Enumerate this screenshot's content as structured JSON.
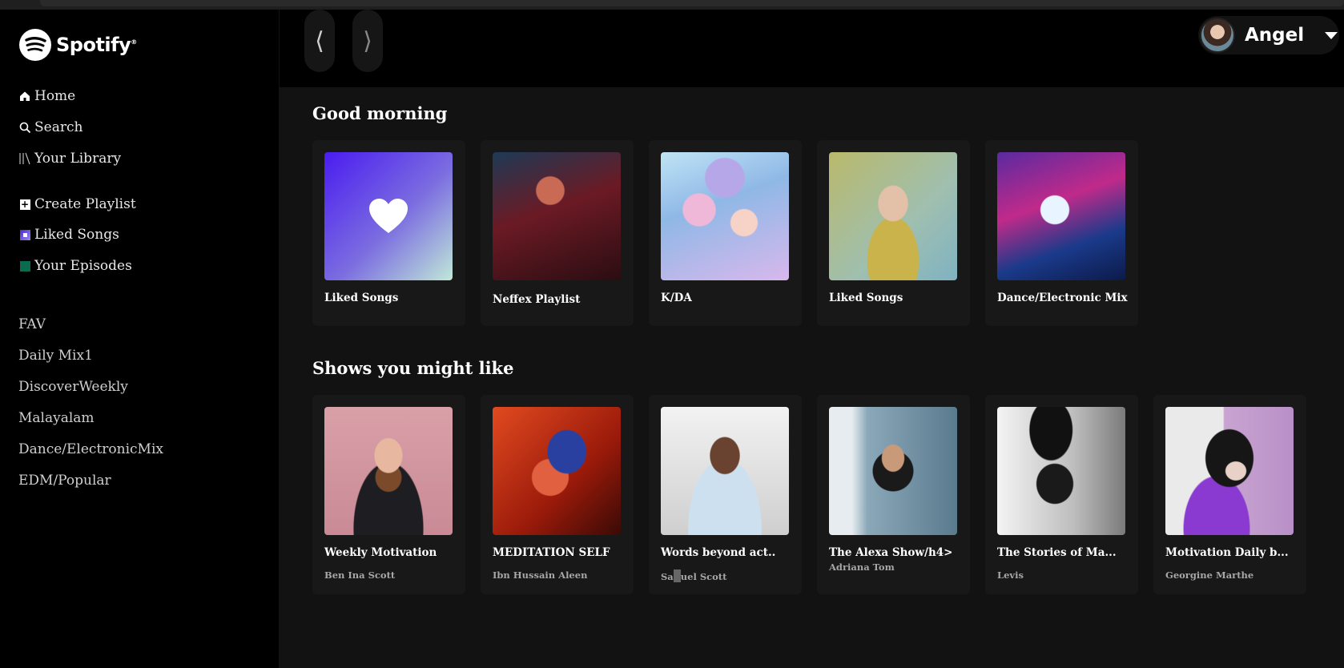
{
  "app": {
    "brand": "Spotify",
    "accent": "#1db954"
  },
  "sidebar": {
    "nav": [
      {
        "label": "Home",
        "icon": "home-icon"
      },
      {
        "label": "Search",
        "icon": "search-icon"
      },
      {
        "label": "Your Library",
        "icon": "library-icon"
      }
    ],
    "actions": [
      {
        "label": "Create Playlist",
        "icon": "plus-square-icon"
      },
      {
        "label": "Liked Songs",
        "icon": "liked-songs-icon"
      },
      {
        "label": "Your Episodes",
        "icon": "episodes-icon"
      }
    ],
    "playlists": [
      "FAV",
      "Daily Mix1",
      "DiscoverWeekly",
      "Malayalam",
      "Dance/ElectronicMix",
      "EDM/Popular"
    ]
  },
  "topbar": {
    "back_glyph": "⟨",
    "forward_glyph": "⟩",
    "user_name": "Angel"
  },
  "sections": {
    "greeting": {
      "title": "Good morning",
      "cards": [
        {
          "title": "Liked Songs"
        },
        {
          "title": "Neffex Playlist"
        },
        {
          "title": "K/DA"
        },
        {
          "title": "Liked Songs"
        },
        {
          "title": "Dance/Electronic Mix"
        }
      ]
    },
    "shows": {
      "title": "Shows you might like",
      "cards": [
        {
          "title": "Weekly Motivation",
          "subtitle": "Ben Ina Scott"
        },
        {
          "title": "MEDITATION SELF",
          "subtitle": "Ibn Hussain Aleen"
        },
        {
          "title": "Words beyond act..",
          "subtitle_a": "Sa",
          "subtitle_b": "uel Scott"
        },
        {
          "title": "The Alexa Show/h4>",
          "subtitle": "Adriana Tom"
        },
        {
          "title": "The Stories of Ma...",
          "subtitle": "Levis"
        },
        {
          "title": "Motivation Daily b...",
          "subtitle": "Georgine Marthe"
        }
      ]
    }
  }
}
